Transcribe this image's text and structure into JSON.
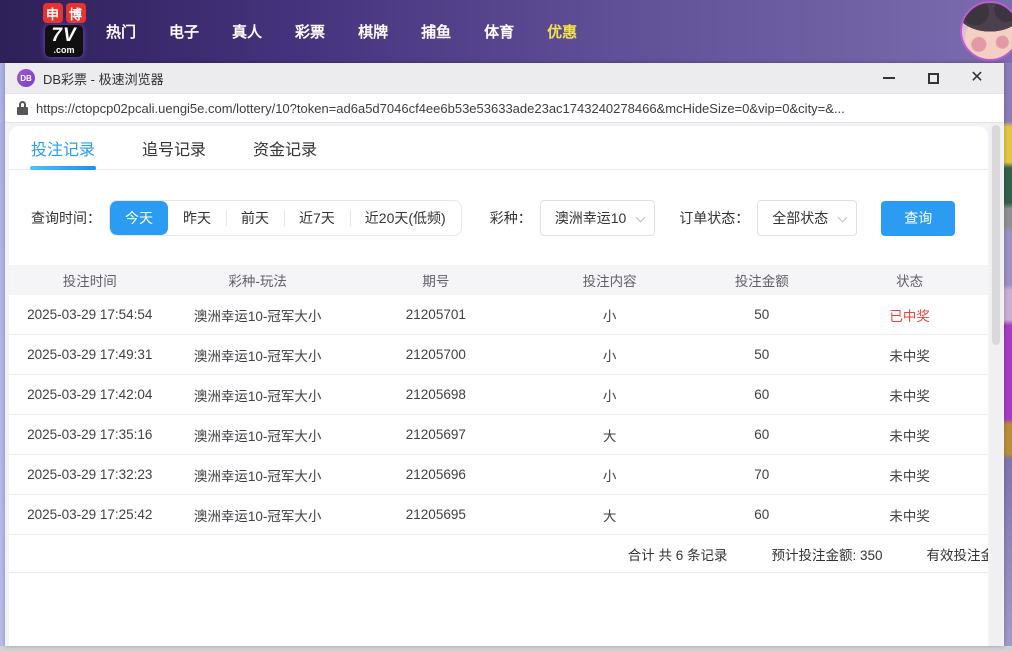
{
  "banner": {
    "logo": {
      "badge1": "申",
      "badge2": "博",
      "main": "7V",
      "suffix": ".com"
    },
    "nav": [
      {
        "label": "热门",
        "active": false
      },
      {
        "label": "电子",
        "active": false
      },
      {
        "label": "真人",
        "active": false
      },
      {
        "label": "彩票",
        "active": false
      },
      {
        "label": "棋牌",
        "active": false
      },
      {
        "label": "捕鱼",
        "active": false
      },
      {
        "label": "体育",
        "active": false
      },
      {
        "label": "优惠",
        "active": true
      }
    ]
  },
  "window": {
    "icon_text": "DB",
    "title": "DB彩票 - 极速浏览器",
    "url": "https://ctopcp02pcali.uengi5e.com/lottery/10?token=ad6a5d7046cf4ee6b53e53633ade23ac1743240278466&mcHideSize=0&vip=0&city=&..."
  },
  "tabs": [
    {
      "label": "投注记录",
      "active": true
    },
    {
      "label": "追号记录",
      "active": false
    },
    {
      "label": "资金记录",
      "active": false
    }
  ],
  "filters": {
    "time_label": "查询时间：",
    "time_options": [
      {
        "label": "今天",
        "active": true
      },
      {
        "label": "昨天",
        "active": false
      },
      {
        "label": "前天",
        "active": false
      },
      {
        "label": "近7天",
        "active": false
      },
      {
        "label": "近20天(低频)",
        "active": false
      }
    ],
    "lottery_label": "彩种：",
    "lottery_value": "澳洲幸运10",
    "status_label": "订单状态：",
    "status_value": "全部状态",
    "query_button": "查询"
  },
  "table": {
    "columns": [
      "投注时间",
      "彩种-玩法",
      "期号",
      "投注内容",
      "投注金额",
      "状态"
    ],
    "rows": [
      {
        "time": "2025-03-29 17:54:54",
        "game": "澳洲幸运10-冠军大小",
        "issue": "21205701",
        "content": "小",
        "amount": "50",
        "status": "已中奖",
        "won": true
      },
      {
        "time": "2025-03-29 17:49:31",
        "game": "澳洲幸运10-冠军大小",
        "issue": "21205700",
        "content": "小",
        "amount": "50",
        "status": "未中奖",
        "won": false
      },
      {
        "time": "2025-03-29 17:42:04",
        "game": "澳洲幸运10-冠军大小",
        "issue": "21205698",
        "content": "小",
        "amount": "60",
        "status": "未中奖",
        "won": false
      },
      {
        "time": "2025-03-29 17:35:16",
        "game": "澳洲幸运10-冠军大小",
        "issue": "21205697",
        "content": "大",
        "amount": "60",
        "status": "未中奖",
        "won": false
      },
      {
        "time": "2025-03-29 17:32:23",
        "game": "澳洲幸运10-冠军大小",
        "issue": "21205696",
        "content": "小",
        "amount": "70",
        "status": "未中奖",
        "won": false
      },
      {
        "time": "2025-03-29 17:25:42",
        "game": "澳洲幸运10-冠军大小",
        "issue": "21205695",
        "content": "大",
        "amount": "60",
        "status": "未中奖",
        "won": false
      }
    ]
  },
  "summary": {
    "total": "合计 共 6 条记录",
    "expected": "预计投注金额: 350",
    "valid": "有效投注金"
  },
  "colors": {
    "accent": "#2b9cf2",
    "win_status": "#e6443c",
    "banner_left": "#2e2058",
    "banner_right": "#7b6cae",
    "nav_active": "#f2e24e"
  }
}
